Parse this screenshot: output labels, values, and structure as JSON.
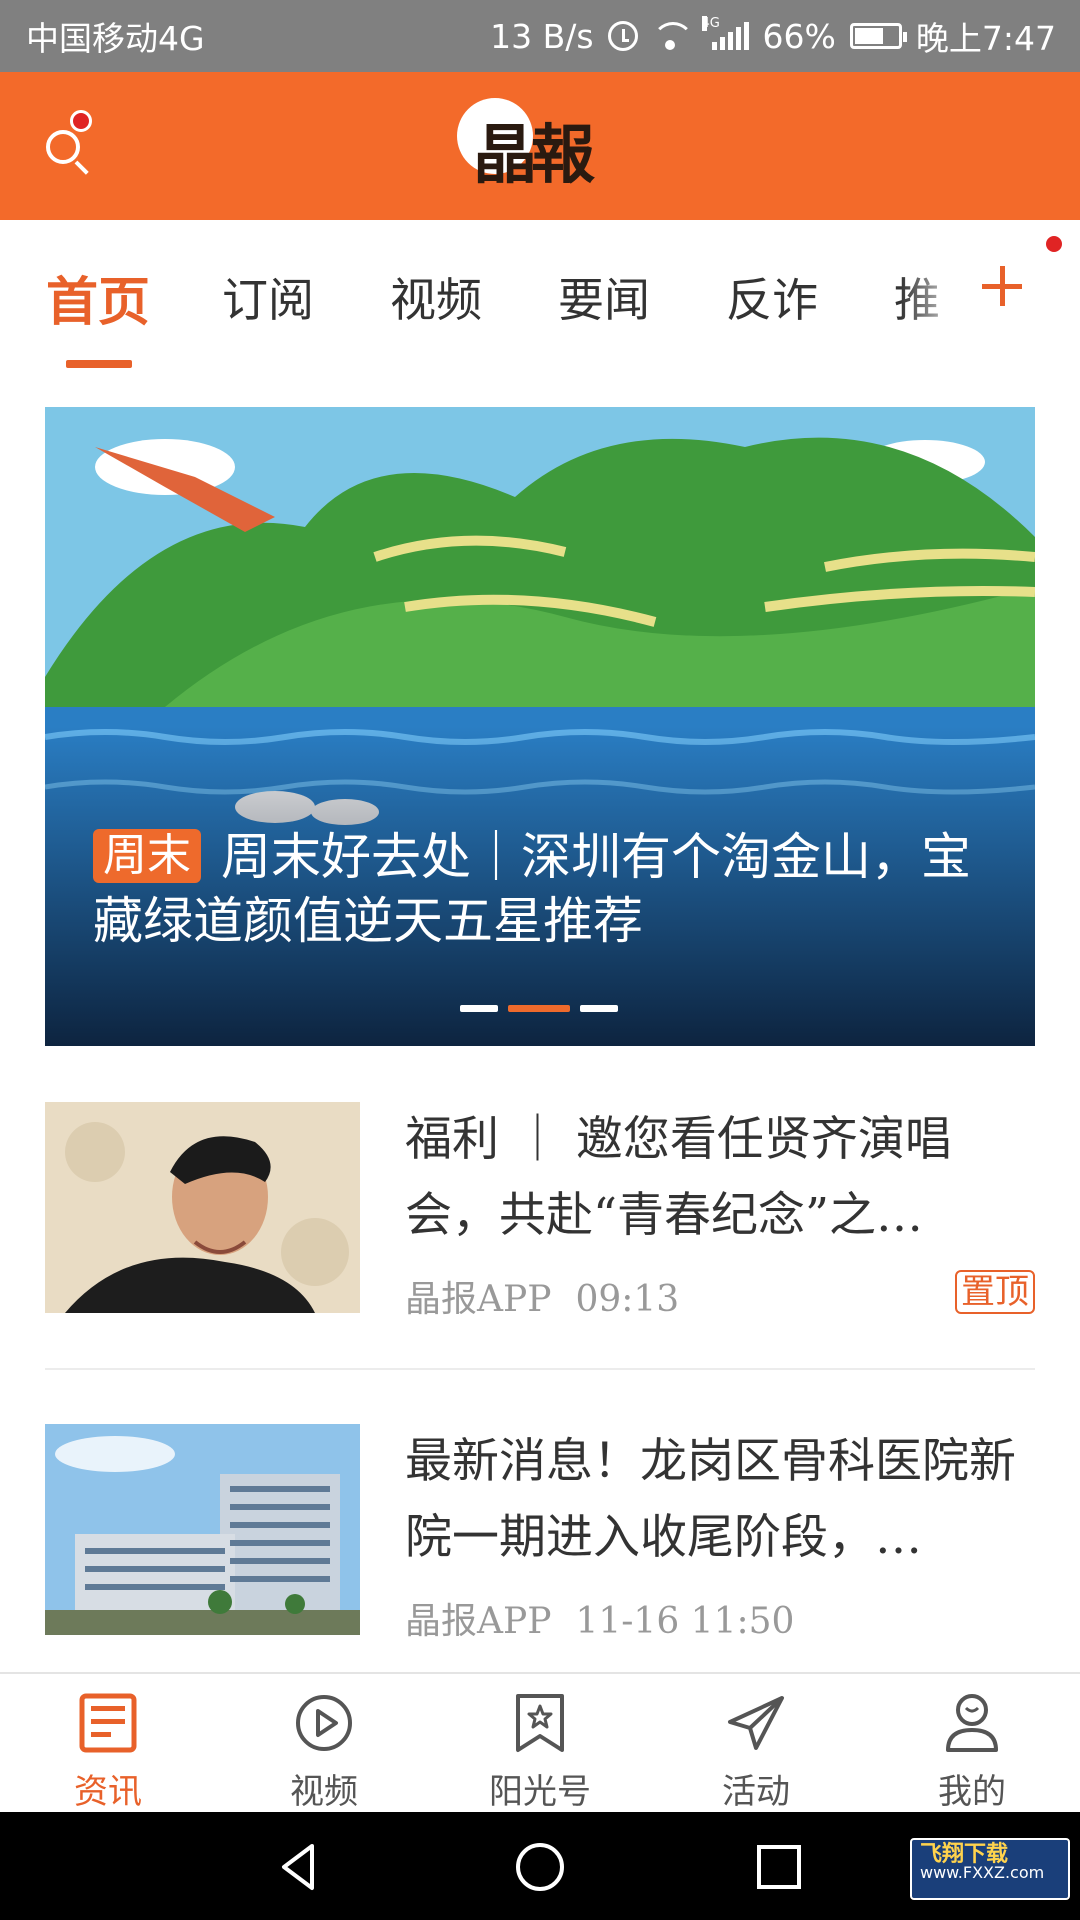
{
  "status_bar": {
    "carrier": "中国移动4G",
    "net_speed": "13 B/s",
    "signal_label": "4G",
    "battery": "66%",
    "battery_level": 0.66,
    "time": "晚上7:47"
  },
  "header": {
    "logo_text": "晶報"
  },
  "channel_tabs": [
    {
      "label": "首页",
      "active": true
    },
    {
      "label": "订阅"
    },
    {
      "label": "视频"
    },
    {
      "label": "要闻"
    },
    {
      "label": "反诈"
    },
    {
      "label": "推"
    }
  ],
  "banner": {
    "tag": "周末",
    "title": "周末好去处｜深圳有个淘金山，宝藏绿道颜值逆天五星推荐",
    "slide_count": 3,
    "active_slide": 2
  },
  "news": [
    {
      "title": "福利 ｜ 邀您看任贤齐演唱会，共赴“青春纪念”之…",
      "source": "晶报APP",
      "time": "09:13",
      "badge": "置顶"
    },
    {
      "title": "最新消息！龙岗区骨科医院新院一期进入收尾阶段，…",
      "source": "晶报APP",
      "time": "11-16  11:50"
    }
  ],
  "bottom_nav": [
    {
      "label": "资讯",
      "icon": "news-icon",
      "active": true
    },
    {
      "label": "视频",
      "icon": "video-icon"
    },
    {
      "label": "阳光号",
      "icon": "bookmark-star-icon"
    },
    {
      "label": "活动",
      "icon": "paper-plane-icon"
    },
    {
      "label": "我的",
      "icon": "user-icon"
    }
  ],
  "watermark": {
    "name": "飞翔下载",
    "url": "www.FXXZ.com"
  },
  "colors": {
    "brand": "#f36a2a",
    "accent": "#e8612a",
    "status_bar": "#808080",
    "notification_dot": "#e02424"
  }
}
